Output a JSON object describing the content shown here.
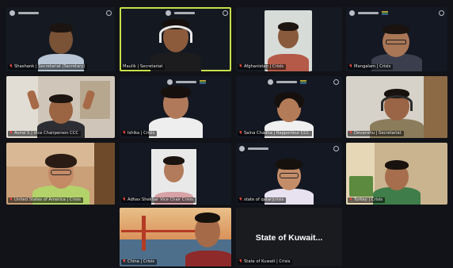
{
  "participants": [
    {
      "name": "Shashank | Secretariat (Secretary)",
      "muted": true
    },
    {
      "name": "Maulik | Secretariat",
      "muted": false,
      "active": true
    },
    {
      "name": "Afghanistan | Crisis",
      "muted": true
    },
    {
      "name": "Mangalam | Crisis",
      "muted": true
    },
    {
      "name": "Aviral S | Vice Chairperson CCC",
      "muted": true
    },
    {
      "name": "Ishika | Crisis",
      "muted": true
    },
    {
      "name": "Saina Chadha | Rapporteur CCC",
      "muted": true
    },
    {
      "name": "Devanshu | Secretariat",
      "muted": true
    },
    {
      "name": "United States of America | Crisis",
      "muted": true
    },
    {
      "name": "Adhav Shekhar Vice Chair Crisis",
      "muted": true
    },
    {
      "name": "state of qatar|crisis",
      "muted": true
    },
    {
      "name": "Turkey | Crisis",
      "muted": true
    },
    {
      "name": "China | Crisis",
      "muted": true
    },
    {
      "name": "State of Kuwait | Crisis",
      "muted": true
    }
  ],
  "kuwait_display_text": "State of Kuwait...",
  "colors": {
    "active_border": "#c6e04a",
    "muted_icon": "#e8493f",
    "background": "#111318"
  }
}
